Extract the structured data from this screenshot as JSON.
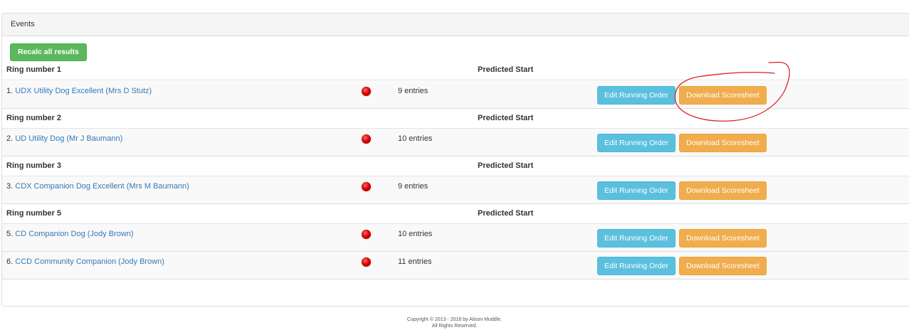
{
  "panel": {
    "title": "Events"
  },
  "toolbar": {
    "recalc_label": "Recalc all results"
  },
  "predicted_start_label": "Predicted Start",
  "rings": [
    {
      "name": "Ring number 1",
      "classes": [
        {
          "number": "1.",
          "name": "UDX Utility Dog Excellent (Mrs D Stutz)",
          "entries": "9 entries"
        }
      ]
    },
    {
      "name": "Ring number 2",
      "classes": [
        {
          "number": "2.",
          "name": "UD Utility Dog (Mr J Baumann)",
          "entries": "10 entries"
        }
      ]
    },
    {
      "name": "Ring number 3",
      "classes": [
        {
          "number": "3.",
          "name": "CDX Companion Dog Excellent (Mrs M Baumann)",
          "entries": "9 entries"
        }
      ]
    },
    {
      "name": "Ring number 5",
      "classes": [
        {
          "number": "5.",
          "name": "CD Companion Dog (Jody Brown)",
          "entries": "10 entries"
        },
        {
          "number": "6.",
          "name": "CCD Community Companion (Jody Brown)",
          "entries": "11 entries"
        }
      ]
    }
  ],
  "buttons": {
    "edit_label": "Edit Running Order",
    "download_label": "Download Scoresheet"
  },
  "status_icon": "red-status-dot-icon",
  "colors": {
    "success": "#5cb85c",
    "info": "#5bc0de",
    "warning": "#f0ad4e",
    "link": "#337ab7",
    "annotation": "#e02020"
  },
  "footer": {
    "copyright": "Copyright © 2013 - 2018 by Alison Muddle.",
    "rights": "All Rights Reserved."
  }
}
